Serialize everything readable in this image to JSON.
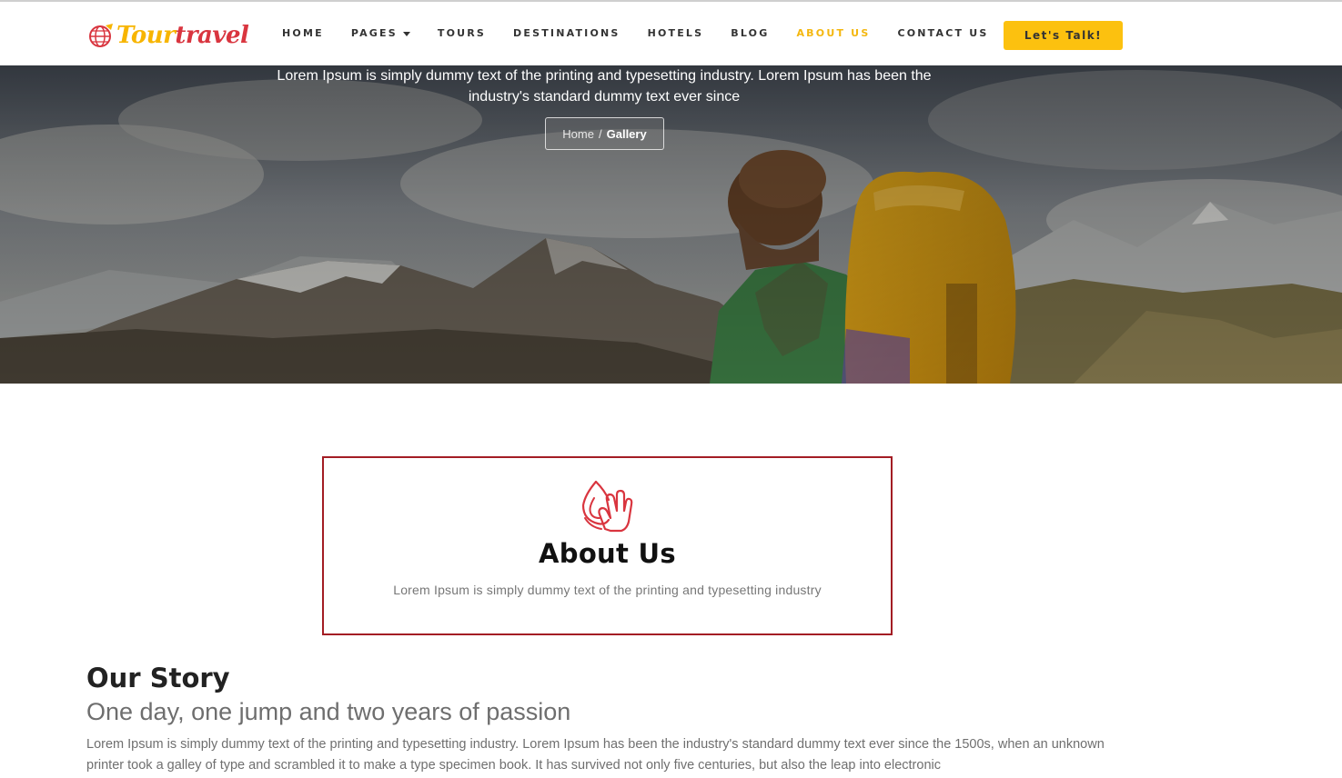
{
  "header": {
    "logo": {
      "part1": "Tour",
      "part2": "travel"
    },
    "nav": [
      {
        "label": "HOME",
        "active": false
      },
      {
        "label": "PAGES",
        "active": false,
        "dropdown": true
      },
      {
        "label": "TOURS",
        "active": false
      },
      {
        "label": "DESTINATIONS",
        "active": false
      },
      {
        "label": "HOTELS",
        "active": false
      },
      {
        "label": "BLOG",
        "active": false
      },
      {
        "label": "ABOUT US",
        "active": true
      },
      {
        "label": "CONTACT US",
        "active": false
      }
    ],
    "cta_label": "Let's Talk!"
  },
  "hero": {
    "text_line1": "Lorem Ipsum is simply dummy text of the printing and typesetting industry. Lorem Ipsum has been the",
    "text_line2": "industry's standard dummy text ever since",
    "breadcrumb": {
      "home": "Home",
      "separator": "/",
      "current": "Gallery"
    }
  },
  "about": {
    "icon": "hand-flame-icon",
    "title": "About Us",
    "subtitle": "Lorem Ipsum is simply dummy text of the printing and typesetting industry"
  },
  "story": {
    "title": "Our Story",
    "subtitle": "One day, one jump and two years of passion",
    "body": "Lorem Ipsum is simply dummy text of the printing and typesetting industry. Lorem Ipsum has been the industry's standard dummy text ever since the 1500s, when an unknown printer took a galley of type and scrambled it to make a type specimen book. It has survived not only five centuries, but also the leap into electronic"
  },
  "colors": {
    "accent": "#fcc10f",
    "active_nav": "#f4b70f",
    "brand_red": "#d9353f",
    "box_border": "#a31d24"
  }
}
